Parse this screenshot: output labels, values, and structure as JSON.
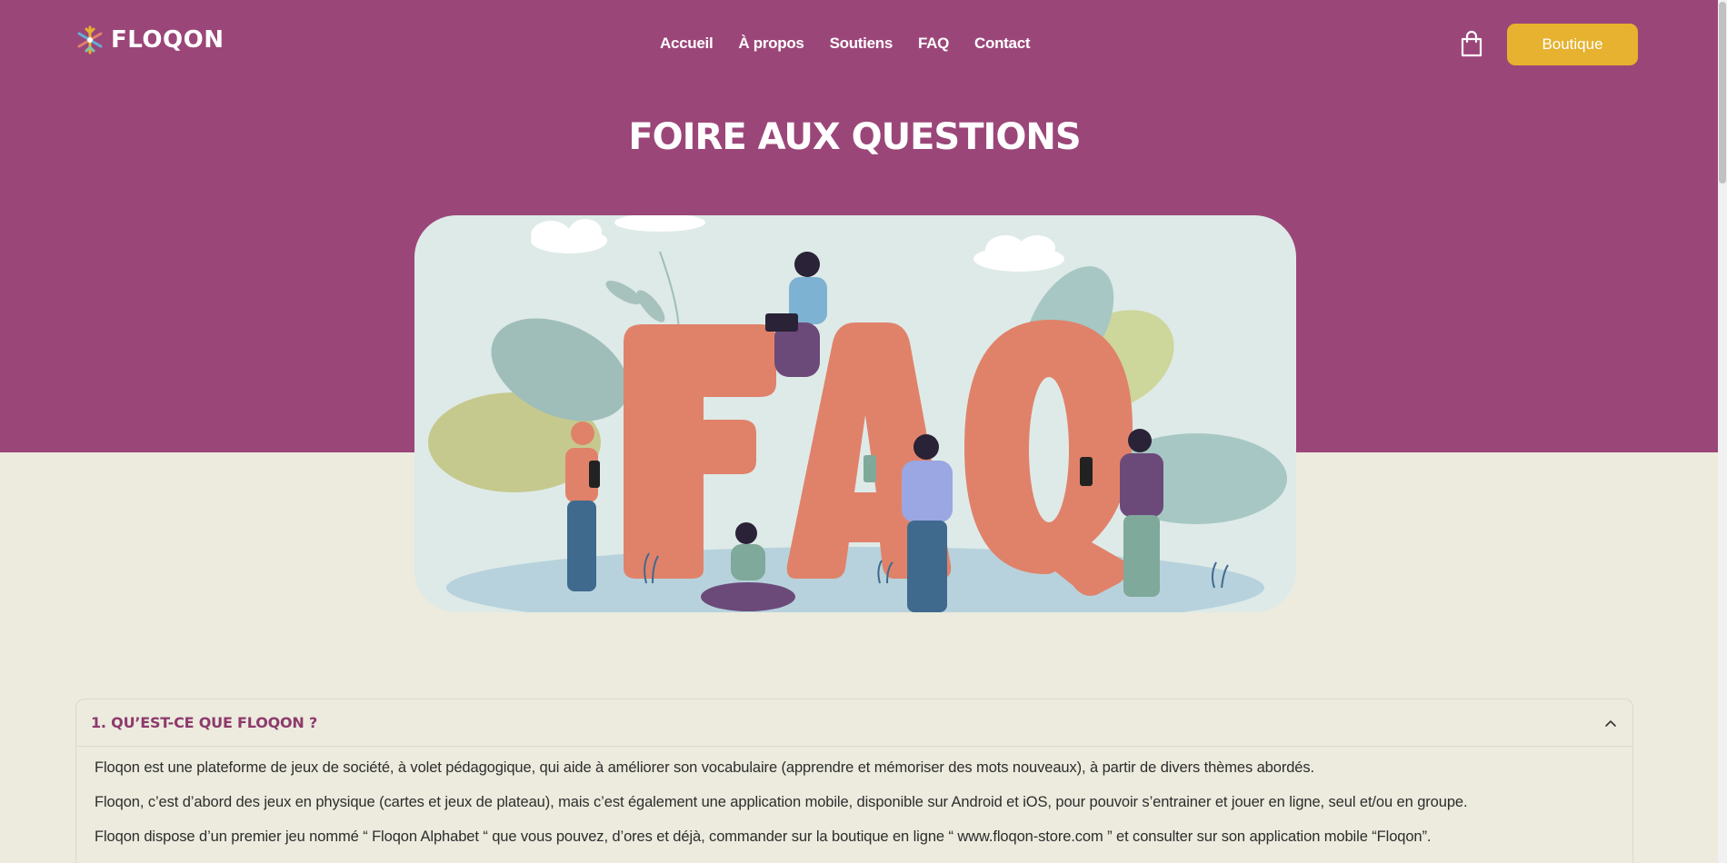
{
  "brand": {
    "name": "FLOQON",
    "icon": "snowflake-logo-icon"
  },
  "nav": {
    "items": [
      {
        "label": "Accueil"
      },
      {
        "label": "À propos"
      },
      {
        "label": "Soutiens"
      },
      {
        "label": "FAQ"
      },
      {
        "label": "Contact"
      }
    ]
  },
  "header": {
    "cart_icon": "shopping-bag-icon",
    "shop_label": "Boutique"
  },
  "hero": {
    "title": "FOIRE AUX QUESTIONS",
    "image_text": "FAQ"
  },
  "faq": {
    "items": [
      {
        "question": "1. QU’EST-CE QUE FLOQON ?",
        "expanded": true,
        "answer": [
          "Floqon est une plateforme de jeux de société, à volet pédagogique, qui aide à améliorer son vocabulaire (apprendre et mémoriser des mots nouveaux), à partir de divers thèmes abordés.",
          "Floqon, c’est d’abord des jeux en physique (cartes et jeux de plateau), mais c’est également une application mobile, disponible sur Android et iOS, pour pouvoir s’entrainer et jouer en ligne, seul et/ou en groupe.",
          "Floqon dispose d’un premier jeu nommé “ Floqon Alphabet “ que vous pouvez, d’ores et déjà, commander sur la boutique en ligne “ www.floqon-store.com ” et consulter sur son application mobile “Floqon”."
        ]
      }
    ]
  },
  "colors": {
    "hero_bg": "#9b4679",
    "page_bg": "#ecebde",
    "accent": "#e6b22f",
    "question_text": "#8d3a6c",
    "faq_letters": "#e0826a"
  }
}
